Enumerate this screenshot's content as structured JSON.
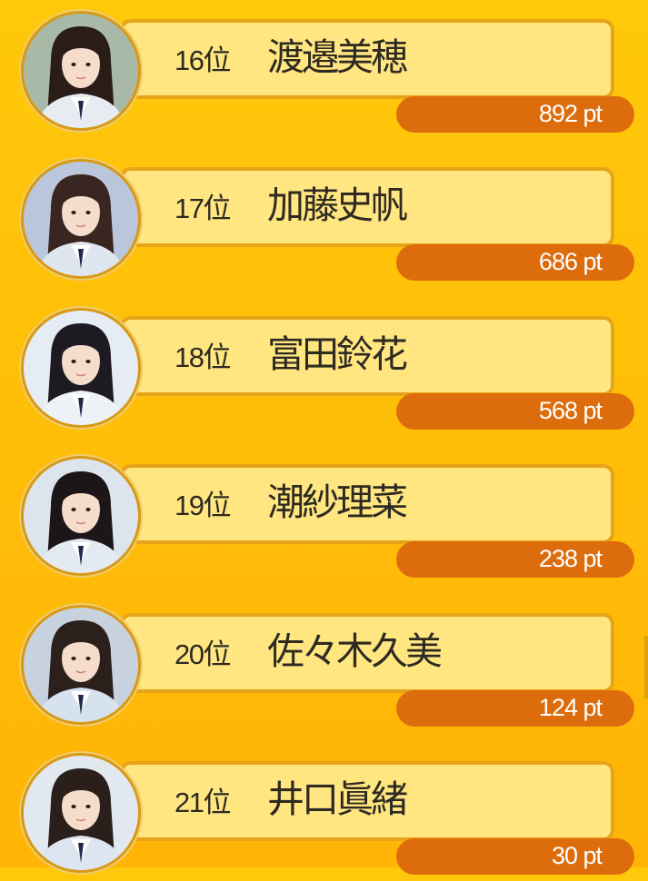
{
  "ranking": [
    {
      "rank": "16位",
      "name": "渡邉美穂",
      "points": "892 pt",
      "photo_bg": "#a9b9a7",
      "hair": "#2a1d18",
      "uniform": "#e8ecf2"
    },
    {
      "rank": "17位",
      "name": "加藤史帆",
      "points": "686 pt",
      "photo_bg": "#b9c6db",
      "hair": "#3a2620",
      "uniform": "#dfe6f0"
    },
    {
      "rank": "18位",
      "name": "富田鈴花",
      "points": "568 pt",
      "photo_bg": "#e6ecf4",
      "hair": "#1e1a22",
      "uniform": "#eef2f7"
    },
    {
      "rank": "19位",
      "name": "潮紗理菜",
      "points": "238 pt",
      "photo_bg": "#dce4ee",
      "hair": "#1c1618",
      "uniform": "#e4eaf2"
    },
    {
      "rank": "20位",
      "name": "佐々木久美",
      "points": "124 pt",
      "photo_bg": "#c8d2de",
      "hair": "#2b201c",
      "uniform": "#d6e2ee"
    },
    {
      "rank": "21位",
      "name": "井口眞緒",
      "points": "30 pt",
      "photo_bg": "#e2e8f0",
      "hair": "#2a1f1b",
      "uniform": "#dde6f0"
    }
  ],
  "colors": {
    "background": "#ffbe08",
    "card": "#ffe680",
    "card_border": "#e8a418",
    "points_pill": "#dd6c0c",
    "avatar_ring": "#d89a16"
  }
}
